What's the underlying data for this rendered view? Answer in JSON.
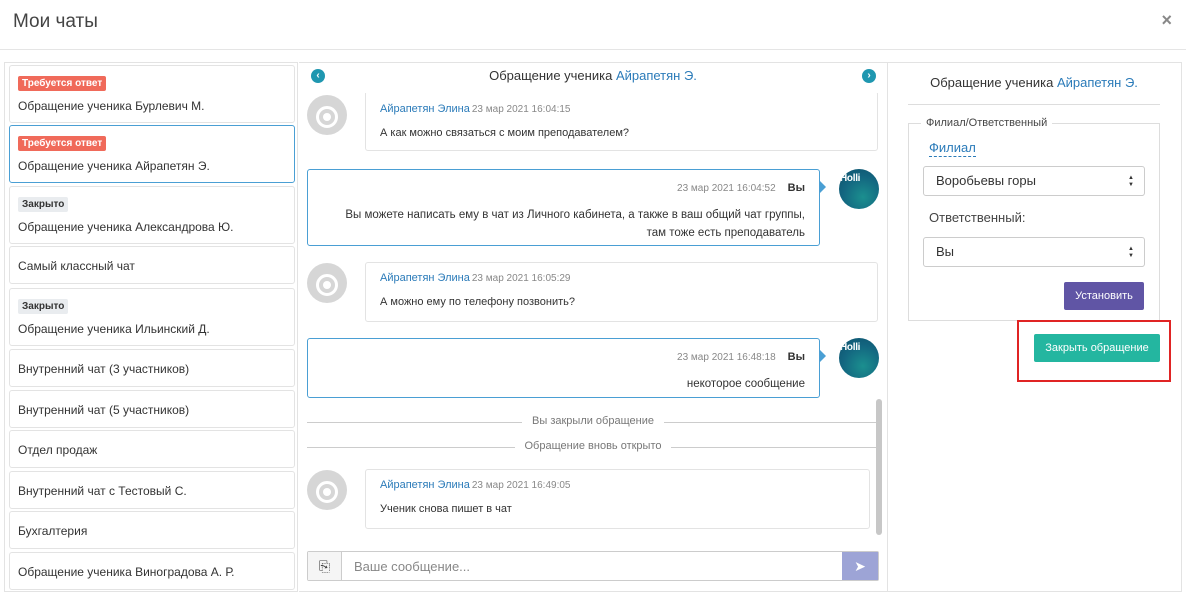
{
  "header": {
    "title": "Мои чаты",
    "close": "×"
  },
  "chats": [
    {
      "badge": "Требуется ответ",
      "badge_type": "red",
      "name": "Обращение ученика Бурлевич М."
    },
    {
      "badge": "Требуется ответ",
      "badge_type": "red",
      "name": "Обращение ученика Айрапетян Э.",
      "active": true
    },
    {
      "badge": "Закрыто",
      "badge_type": "grey",
      "name": "Обращение ученика Александрова Ю."
    },
    {
      "name": "Самый классный чат"
    },
    {
      "badge": "Закрыто",
      "badge_type": "grey",
      "name": "Обращение ученика Ильинский Д."
    },
    {
      "name": "Внутренний чат (3 участников)"
    },
    {
      "name": "Внутренний чат (5 участников)"
    },
    {
      "name": "Отдел продаж"
    },
    {
      "name": "Внутренний чат с Тестовый С."
    },
    {
      "name": "Бухгалтерия"
    },
    {
      "name": "Обращение ученика Виноградова А. Р."
    }
  ],
  "conversation": {
    "title_prefix": "Обращение ученика",
    "title_name": "Айрапетян Э.",
    "prev_icon": "chevron-left-icon",
    "next_icon": "chevron-right-icon",
    "messages": [
      {
        "dir": "in",
        "author": "Айрапетян Элина",
        "time": "23 мар 2021 16:04:15",
        "text": "А как можно связаться с моим преподавателем?"
      },
      {
        "dir": "out",
        "author": "Вы",
        "time": "23 мар 2021 16:04:52",
        "text1": "Вы можете написать ему в чат из Личного кабинета, а также в ваш общий чат группы,",
        "text2": "там тоже есть преподаватель"
      },
      {
        "dir": "in",
        "author": "Айрапетян Элина",
        "time": "23 мар 2021 16:05:29",
        "text": "А можно ему по телефону позвонить?"
      },
      {
        "dir": "out",
        "author": "Вы",
        "time": "23 мар 2021 16:48:18",
        "text1": "некоторое сообщение"
      },
      {
        "dir": "sys",
        "text": "Вы закрыли обращение"
      },
      {
        "dir": "sys",
        "text": "Обращение вновь открыто"
      },
      {
        "dir": "in",
        "author": "Айрапетян Элина",
        "time": "23 мар 2021 16:49:05",
        "text": "Ученик снова пишет в чат"
      }
    ],
    "input_placeholder": "Ваше сообщение...",
    "attach_icon": "paperclip-icon",
    "send_icon": "send-icon",
    "avatar_user_text": "Holli"
  },
  "details": {
    "title_prefix": "Обращение ученика",
    "title_name": "Айрапетян Э.",
    "legend": "Филиал/Ответственный",
    "branch_label": "Филиал",
    "branch_value": "Воробьевы горы",
    "responsible_label": "Ответственный:",
    "responsible_value": "Вы",
    "set_button": "Установить",
    "close_button": "Закрыть обращение"
  },
  "colors": {
    "accent": "#2b7bb9",
    "red_badge": "#f06a5a",
    "set_button": "#6055a5",
    "close_button": "#24b6a0",
    "highlight": "#e02424"
  }
}
